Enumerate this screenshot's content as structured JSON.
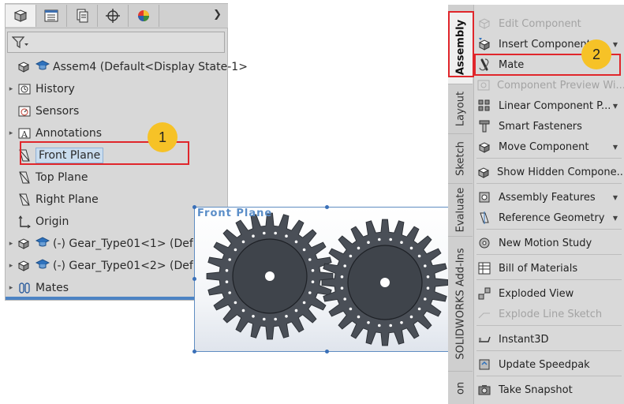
{
  "tree": {
    "tabs": [
      {
        "name": "featuremanager-tab-icon"
      },
      {
        "name": "propertymanager-tab-icon"
      },
      {
        "name": "configurationmanager-tab-icon"
      },
      {
        "name": "dimxpert-tab-icon"
      },
      {
        "name": "display-manager-tab-icon"
      }
    ],
    "items": [
      {
        "label": "Assem4  (Default<Display State-1>",
        "icon": "assembly-icon",
        "expand": false
      },
      {
        "label": "History",
        "icon": "history-icon",
        "expand": true
      },
      {
        "label": "Sensors",
        "icon": "sensors-icon",
        "expand": false
      },
      {
        "label": "Annotations",
        "icon": "annotations-icon",
        "expand": true
      },
      {
        "label": "Front Plane",
        "icon": "plane-icon",
        "expand": false,
        "selected": true
      },
      {
        "label": "Top Plane",
        "icon": "plane-icon",
        "expand": false
      },
      {
        "label": "Right Plane",
        "icon": "plane-icon",
        "expand": false
      },
      {
        "label": "Origin",
        "icon": "origin-icon",
        "expand": false
      },
      {
        "label": "(-) Gear_Type01<1> (Def",
        "icon": "part-icon",
        "expand": true
      },
      {
        "label": "(-) Gear_Type01<2> (Def",
        "icon": "part-icon",
        "expand": true
      },
      {
        "label": "Mates",
        "icon": "mates-icon",
        "expand": true
      }
    ]
  },
  "viewport": {
    "plane_label": "Front Plane"
  },
  "command_manager": {
    "tabs": [
      {
        "label": "Assembly",
        "active": true
      },
      {
        "label": "Layout"
      },
      {
        "label": "Sketch"
      },
      {
        "label": "Evaluate"
      },
      {
        "label": "SOLIDWORKS Add-Ins"
      },
      {
        "label": "on"
      }
    ],
    "commands": [
      {
        "label": "Edit Component",
        "icon": "edit-component-icon",
        "disabled": true,
        "arrow": false
      },
      {
        "label": "Insert Components",
        "icon": "insert-components-icon",
        "disabled": false,
        "arrow": true
      },
      {
        "label": "Mate",
        "icon": "mate-icon",
        "disabled": false,
        "arrow": false
      },
      {
        "label": "Component Preview Wi...",
        "icon": "component-preview-icon",
        "disabled": true,
        "arrow": false
      },
      {
        "label": "Linear Component P...",
        "icon": "linear-pattern-icon",
        "disabled": false,
        "arrow": true
      },
      {
        "label": "Smart Fasteners",
        "icon": "smart-fasteners-icon",
        "disabled": false,
        "arrow": false
      },
      {
        "label": "Move Component",
        "icon": "move-component-icon",
        "disabled": false,
        "arrow": true
      },
      {
        "label": "Show Hidden Compone...",
        "icon": "show-hidden-icon",
        "disabled": false,
        "arrow": false
      },
      {
        "label": "Assembly Features",
        "icon": "assembly-features-icon",
        "disabled": false,
        "arrow": true
      },
      {
        "label": "Reference Geometry",
        "icon": "reference-geometry-icon",
        "disabled": false,
        "arrow": true
      },
      {
        "label": "New Motion Study",
        "icon": "motion-study-icon",
        "disabled": false,
        "arrow": false
      },
      {
        "label": "Bill of Materials",
        "icon": "bill-of-materials-icon",
        "disabled": false,
        "arrow": false
      },
      {
        "label": "Exploded View",
        "icon": "exploded-view-icon",
        "disabled": false,
        "arrow": false
      },
      {
        "label": "Explode Line Sketch",
        "icon": "explode-line-sketch-icon",
        "disabled": true,
        "arrow": false
      },
      {
        "label": "Instant3D",
        "icon": "instant3d-icon",
        "disabled": false,
        "arrow": false
      },
      {
        "label": "Update Speedpak",
        "icon": "speedpak-icon",
        "disabled": false,
        "arrow": false
      },
      {
        "label": "Take Snapshot",
        "icon": "snapshot-icon",
        "disabled": false,
        "arrow": false
      }
    ]
  },
  "callouts": {
    "step1": "1",
    "step2": "2"
  },
  "colors": {
    "highlight_red": "#e0262b",
    "badge_yellow": "#f6c227",
    "gear_fill": "#4a4f57",
    "selection_blue": "#5f8dc2"
  }
}
